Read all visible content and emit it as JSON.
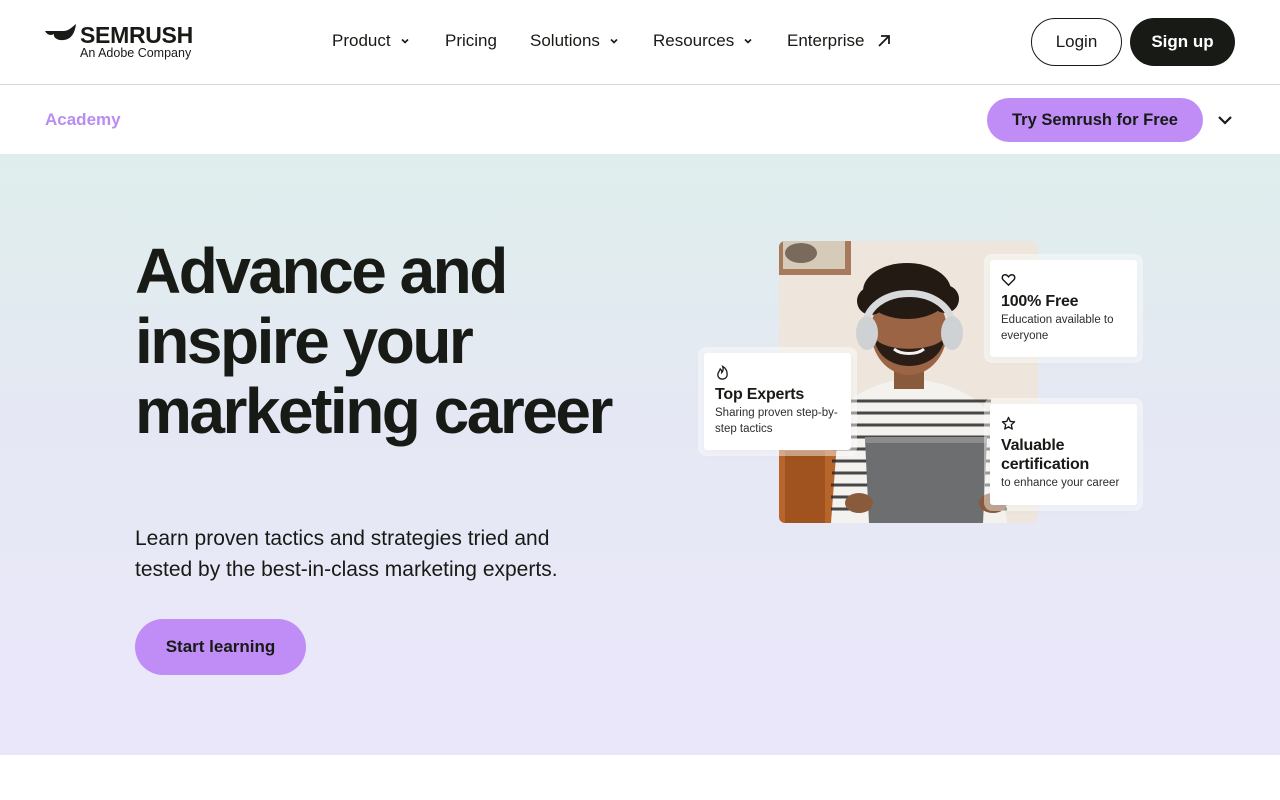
{
  "header": {
    "logo": {
      "name": "SEMRUSH",
      "tagline": "An Adobe Company"
    },
    "nav": [
      {
        "label": "Product",
        "has_dropdown": true
      },
      {
        "label": "Pricing",
        "has_dropdown": false
      },
      {
        "label": "Solutions",
        "has_dropdown": true
      },
      {
        "label": "Resources",
        "has_dropdown": true
      },
      {
        "label": "Enterprise",
        "external": true
      }
    ],
    "login_label": "Login",
    "signup_label": "Sign up"
  },
  "subbar": {
    "section_label": "Academy",
    "cta_label": "Try Semrush for Free"
  },
  "hero": {
    "title": "Advance and inspire your marketing career",
    "subtitle": "Learn proven tactics and strategies tried and tested by the best-in-class marketing experts.",
    "cta_label": "Start learning",
    "cards": [
      {
        "icon": "heart-icon",
        "title": "100% Free",
        "text": "Education available to everyone"
      },
      {
        "icon": "flame-icon",
        "title": "Top Experts",
        "text": "Sharing proven step-by-step tactics"
      },
      {
        "icon": "star-icon",
        "title": "Valuable certification",
        "text": "to enhance your career"
      }
    ]
  },
  "colors": {
    "accent": "#c08df7",
    "academy_link": "#b98cf2",
    "dark": "#171a15",
    "hero_gradient_top": "#dfeeec",
    "hero_gradient_bottom": "#ebe7fb"
  }
}
